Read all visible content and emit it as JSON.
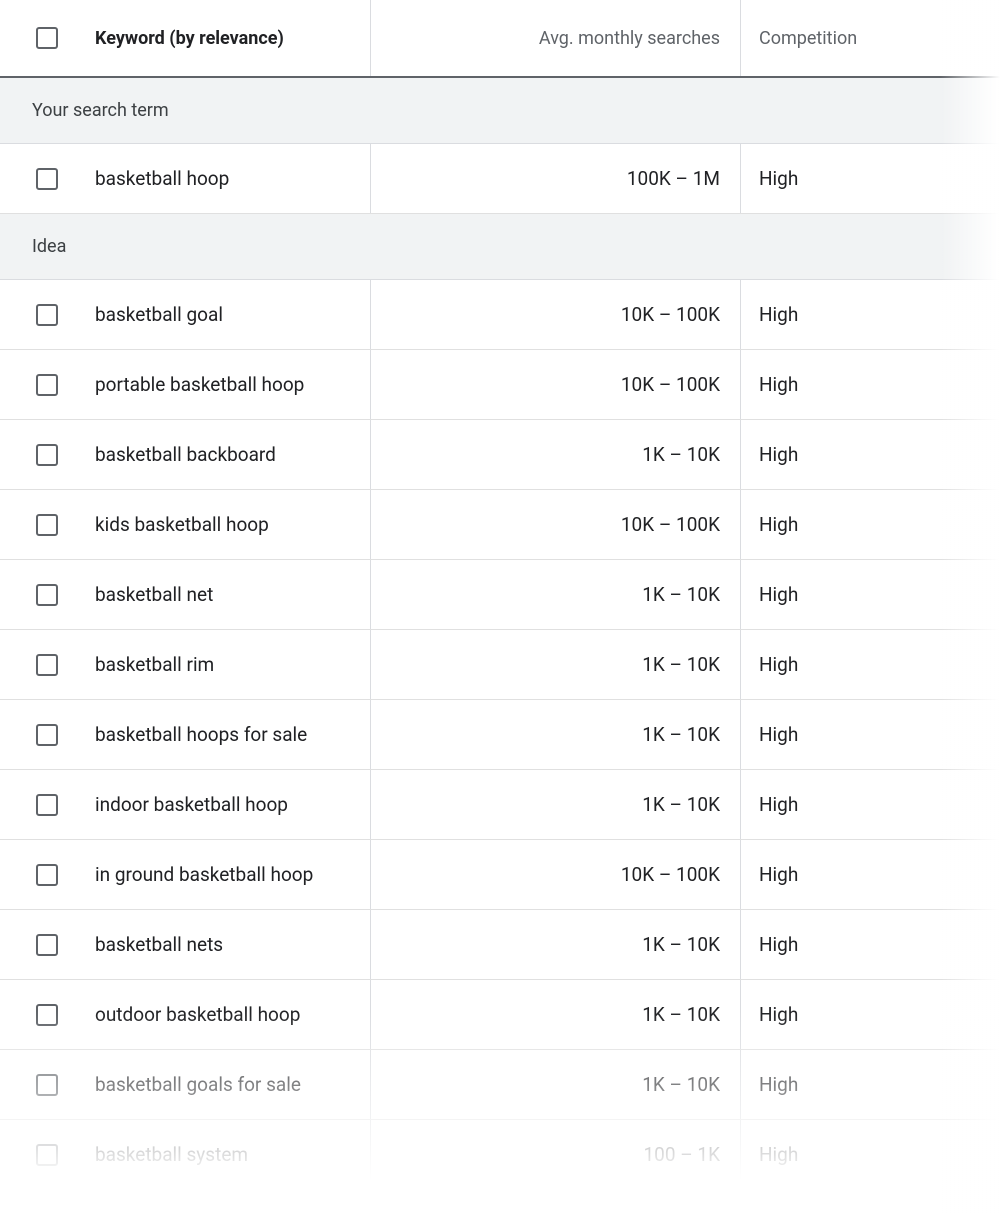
{
  "columns": {
    "keyword": "Keyword (by relevance)",
    "searches": "Avg. monthly searches",
    "competition": "Competition"
  },
  "sections": [
    {
      "title": "Your search term",
      "rows": [
        {
          "keyword": "basketball hoop",
          "searches": "100K – 1M",
          "competition": "High"
        }
      ]
    },
    {
      "title": "Idea",
      "rows": [
        {
          "keyword": "basketball goal",
          "searches": "10K – 100K",
          "competition": "High"
        },
        {
          "keyword": "portable basketball hoop",
          "searches": "10K – 100K",
          "competition": "High"
        },
        {
          "keyword": "basketball backboard",
          "searches": "1K – 10K",
          "competition": "High"
        },
        {
          "keyword": "kids basketball hoop",
          "searches": "10K – 100K",
          "competition": "High"
        },
        {
          "keyword": "basketball net",
          "searches": "1K – 10K",
          "competition": "High"
        },
        {
          "keyword": "basketball rim",
          "searches": "1K – 10K",
          "competition": "High"
        },
        {
          "keyword": "basketball hoops for sale",
          "searches": "1K – 10K",
          "competition": "High"
        },
        {
          "keyword": "indoor basketball hoop",
          "searches": "1K – 10K",
          "competition": "High"
        },
        {
          "keyword": "in ground basketball hoop",
          "searches": "10K – 100K",
          "competition": "High"
        },
        {
          "keyword": "basketball nets",
          "searches": "1K – 10K",
          "competition": "High"
        },
        {
          "keyword": "outdoor basketball hoop",
          "searches": "1K – 10K",
          "competition": "High"
        },
        {
          "keyword": "basketball goals for sale",
          "searches": "1K – 10K",
          "competition": "High"
        },
        {
          "keyword": "basketball system",
          "searches": "100 – 1K",
          "competition": "High"
        }
      ]
    }
  ]
}
